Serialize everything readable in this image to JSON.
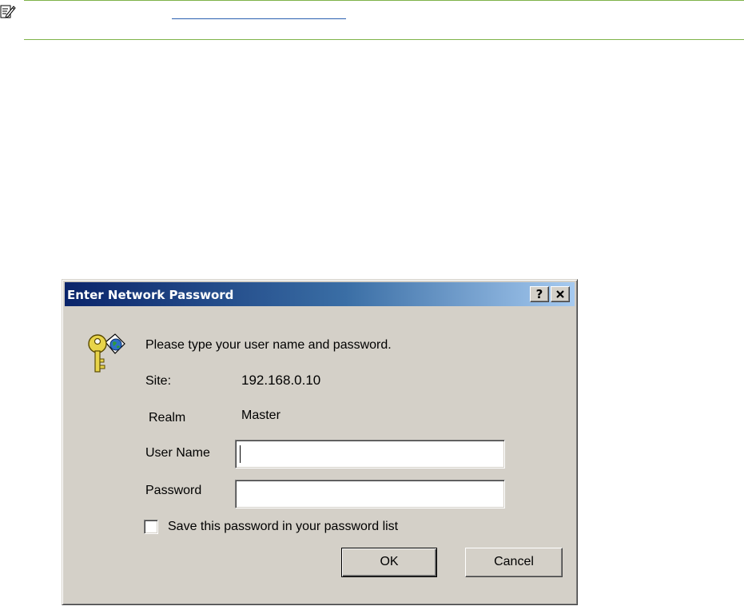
{
  "note": {
    "icon": "note-pencil-icon",
    "link_text": "",
    "rule_color": "#7fb34a",
    "link_color": "#2a5fb0"
  },
  "dialog": {
    "title": "Enter Network Password",
    "help_button_label": "?",
    "close_button_label": "✕",
    "icon": "key-globe-icon",
    "prompt": "Please type your user name and password.",
    "site_label": "Site:",
    "site_value": "192.168.0.10",
    "realm_label": "Realm",
    "realm_value": "Master",
    "user_name_label": "User Name",
    "user_name_value": "",
    "password_label": "Password",
    "password_value": "",
    "save_password_label": "Save this password in your password list",
    "save_password_checked": false,
    "ok_label": "OK",
    "cancel_label": "Cancel",
    "title_bar_colors": [
      "#0a246a",
      "#a6caf0"
    ],
    "face_color": "#d4d0c8"
  }
}
